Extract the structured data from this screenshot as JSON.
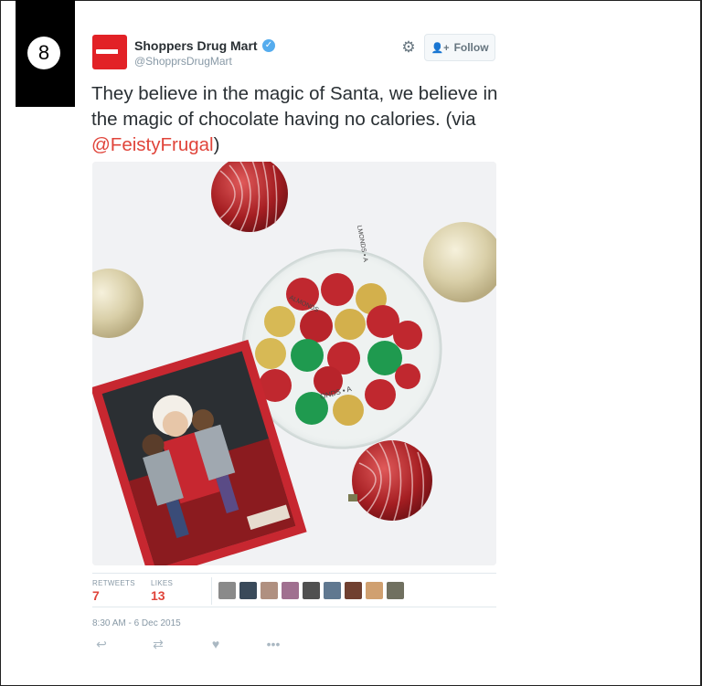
{
  "rank": "8",
  "account": {
    "name": "Shoppers Drug Mart",
    "handle": "@ShopprsDrugMart",
    "verified": true,
    "brand_color": "#e22126"
  },
  "follow_label": "Follow",
  "tweet": {
    "text": "They believe in the magic of Santa, we believe in the magic of chocolate having no calories. (via ",
    "mention": "@FeistyFrugal",
    "text_end": ")"
  },
  "photo_text": {
    "candy_tag_1": "LMONDS • A",
    "candy_tag_2": "ONDS • A",
    "candy_tag_3": "ALMONDS"
  },
  "stats": {
    "retweets_label": "RETWEETS",
    "retweets": "7",
    "likes_label": "LIKES",
    "likes": "13"
  },
  "liker_avatars": [
    "#8a8a8a",
    "#3a4a5a",
    "#b09080",
    "#a07090",
    "#505050",
    "#607890",
    "#704030",
    "#d0a070",
    "#707060"
  ],
  "timestamp": "8:30 AM - 6 Dec 2015",
  "actions": {
    "reply_icon": "reply-icon",
    "retweet_icon": "retweet-icon",
    "like_icon": "heart-icon",
    "more_icon": "more-icon"
  },
  "colors": {
    "accent": "#e0443a",
    "muted": "#8899a6"
  }
}
